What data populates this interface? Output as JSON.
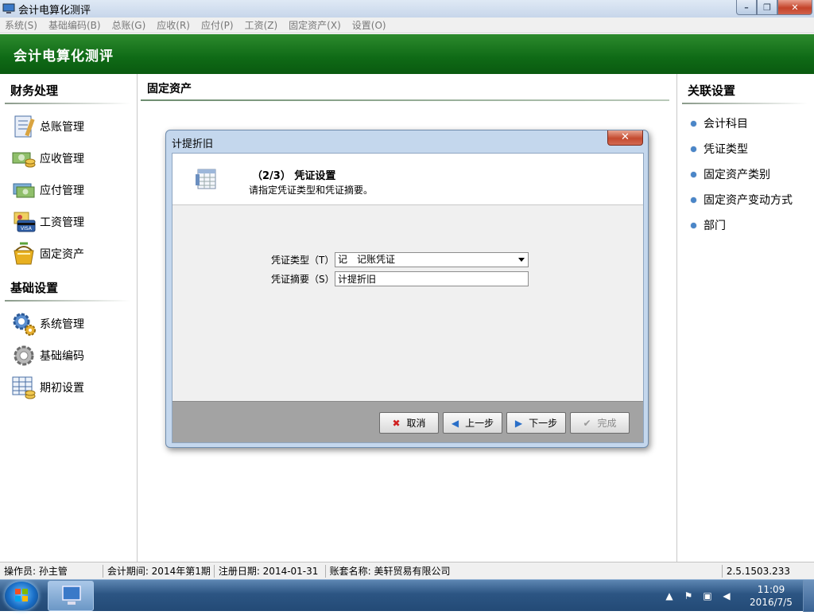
{
  "window": {
    "title": "会计电算化测评"
  },
  "menu": [
    "系统(S)",
    "基础编码(B)",
    "总账(G)",
    "应收(R)",
    "应付(P)",
    "工资(Z)",
    "固定资产(X)",
    "设置(O)"
  ],
  "banner": {
    "title": "会计电算化测评"
  },
  "left": {
    "finance_heading": "财务处理",
    "finance_items": [
      {
        "label": "总账管理",
        "icon": "ledger-icon"
      },
      {
        "label": "应收管理",
        "icon": "receivable-icon"
      },
      {
        "label": "应付管理",
        "icon": "payable-icon"
      },
      {
        "label": "工资管理",
        "icon": "payroll-icon"
      },
      {
        "label": "固定资产",
        "icon": "fixed-asset-icon"
      }
    ],
    "base_heading": "基础设置",
    "base_items": [
      {
        "label": "系统管理",
        "icon": "system-gear-icon"
      },
      {
        "label": "基础编码",
        "icon": "basic-code-icon"
      },
      {
        "label": "期初设置",
        "icon": "opening-setup-icon"
      }
    ]
  },
  "center": {
    "title": "固定资产"
  },
  "right": {
    "heading": "关联设置",
    "links": [
      "会计科目",
      "凭证类型",
      "固定资产类别",
      "固定资产变动方式",
      "部门"
    ]
  },
  "dialog": {
    "title": "计提折旧",
    "step_title": "（2/3） 凭证设置",
    "step_desc": "请指定凭证类型和凭证摘要。",
    "voucher_type_label": "凭证类型（T）:",
    "voucher_type_value": "记　记账凭证",
    "summary_label": "凭证摘要（S）:",
    "summary_value": "计提折旧",
    "buttons": {
      "cancel": "取消",
      "prev": "上一步",
      "next": "下一步",
      "finish": "完成"
    }
  },
  "status": {
    "operator": "操作员: 孙主管",
    "period": "会计期间: 2014年第1期",
    "reg_date": "注册日期: 2014-01-31",
    "account": "账套名称: 美轩贸易有限公司",
    "version": "2.5.1503.233"
  },
  "taskbar": {
    "time": "11:09",
    "date": "2016/7/5"
  },
  "colors": {
    "banner": "#0f6a16",
    "accent_dot": "#4a86c8",
    "taskbar": "#2c5583"
  }
}
